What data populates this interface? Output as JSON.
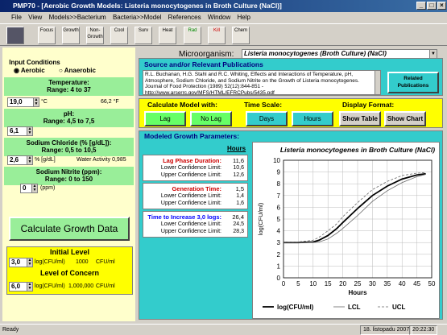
{
  "window": {
    "title": "PMP70 - [Aerobic Growth Models: Listeria monocytogenes in Broth Culture (NaCl)]"
  },
  "menu": [
    "File",
    "View",
    "Models>>Bacterium",
    "Bacteria>>Model",
    "References",
    "Window",
    "Help"
  ],
  "toolbar": [
    "Focus",
    "Growth",
    "Non-Growth",
    "Cool",
    "Surv",
    "Heat",
    "Rad",
    "Kill",
    "Chem"
  ],
  "left": {
    "input_conditions": "Input Conditions",
    "aerobic": "Aerobic",
    "anaerobic": "Anaerobic",
    "temp_label": "Temperature:",
    "temp_range": "Range: 4 to 37",
    "temp_value": "19,0",
    "temp_unit": "°C",
    "temp_f": "66,2 °F",
    "ph_label": "pH:",
    "ph_range": "Range: 4,5 to 7,5",
    "ph_value": "6,1",
    "nacl_label": "Sodium Chloride (% [g/dL]):",
    "nacl_range": "Range: 0,5 to 10,5",
    "nacl_value": "2,6",
    "nacl_unit": "% [g/dL]",
    "water_activity": "Water Activity 0,985",
    "nitrite_label": "Sodium Nitrite (ppm):",
    "nitrite_range": "Range: 0 to 150",
    "nitrite_value": "0",
    "nitrite_unit": "(ppm)",
    "calc_button": "Calculate Growth Data",
    "initial_label": "Initial Level",
    "initial_value": "3,0",
    "initial_unit": "log(CFU/ml)",
    "initial_cfu": "1000",
    "initial_cfu_unit": "CFU/ml",
    "concern_label": "Level of Concern",
    "concern_value": "6,0",
    "concern_unit": "log(CFU/ml)",
    "concern_cfu": "1,000,000",
    "concern_cfu_unit": "CFU/ml"
  },
  "right": {
    "microorganism_label": "Microorganism:",
    "microorganism": "Listeria monocytogenes (Broth Culture) (NaCl)",
    "source_label": "Source and/or Relevant Publications",
    "source_text": "R.L. Buchanan, H.G. Stahl and R.C. Whiting, Effects and Interactions of Temperature, pH, Atmosphere, Sodium Chloride, and Sodium Nitrite on the Growth of Listeria monocytogenes. Journal of Food Protection (1989) 52(12):844-851 - http://www.arserrc.gov/MFS/HTML/EFRCPubs/5435.pdf",
    "related_button": "Related Publications",
    "calc_model_label": "Calculate Model with:",
    "lag_btn": "Lag",
    "nolag_btn": "No Lag",
    "timescale_label": "Time Scale:",
    "days_btn": "Days",
    "hours_btn": "Hours",
    "display_label": "Display Format:",
    "showtable_btn": "Show Table",
    "showchart_btn": "Show Chart",
    "modeled_label": "Modeled Growth Parameters:",
    "hours_label": "Hours",
    "lag_duration": "Lag Phase Duration:",
    "lag_value": "11,6",
    "lag_lower_label": "Lower Confidence Limit:",
    "lag_lower": "10,6",
    "lag_upper_label": "Upper Confidence Limit:",
    "lag_upper": "12,6",
    "gen_time": "Generation Time:",
    "gen_value": "1,5",
    "gen_lower_label": "Lower Confidence Limit:",
    "gen_lower": "1,4",
    "gen_upper_label": "Upper Confidence Limit:",
    "gen_upper": "1,6",
    "increase": "Time to Increase 3,0 logs:",
    "inc_value": "26,4",
    "inc_lower_label": "Lower Confidence Limit:",
    "inc_lower": "24,5",
    "inc_upper_label": "Upper Confidence Limit:",
    "inc_upper": "28,3"
  },
  "chart_data": {
    "type": "line",
    "title": "Listeria monocytogenes in Broth Culture (NaCl)",
    "xlabel": "Hours",
    "ylabel": "log(CFU/ml)",
    "xlim": [
      0,
      50
    ],
    "ylim": [
      0,
      10
    ],
    "xticks": [
      0,
      5,
      10,
      15,
      20,
      25,
      30,
      35,
      40,
      45,
      50
    ],
    "yticks": [
      0,
      1,
      2,
      3,
      4,
      5,
      6,
      7,
      8,
      9,
      10
    ],
    "grid": true,
    "legend_position": "bottom",
    "series": [
      {
        "name": "log(CFU/ml)",
        "x": [
          0,
          5,
          10,
          12,
          15,
          18,
          20,
          25,
          30,
          35,
          40,
          45,
          48
        ],
        "y": [
          3.0,
          3.0,
          3.05,
          3.2,
          3.6,
          4.2,
          4.7,
          5.9,
          7.0,
          7.8,
          8.4,
          8.75,
          8.85
        ]
      },
      {
        "name": "LCL",
        "x": [
          0,
          5,
          10,
          12,
          15,
          18,
          20,
          25,
          30,
          35,
          40,
          45,
          48
        ],
        "y": [
          3.0,
          3.0,
          3.0,
          3.05,
          3.3,
          3.8,
          4.2,
          5.3,
          6.5,
          7.4,
          8.1,
          8.6,
          8.8
        ]
      },
      {
        "name": "UCL",
        "x": [
          0,
          5,
          10,
          12,
          15,
          18,
          20,
          25,
          30,
          35,
          40,
          45,
          48
        ],
        "y": [
          3.0,
          3.05,
          3.2,
          3.45,
          4.0,
          4.6,
          5.2,
          6.4,
          7.5,
          8.2,
          8.7,
          8.9,
          8.95
        ]
      }
    ]
  },
  "status": {
    "ready": "Ready",
    "date": "18. listopadu 2007",
    "time": "20:22:30"
  }
}
